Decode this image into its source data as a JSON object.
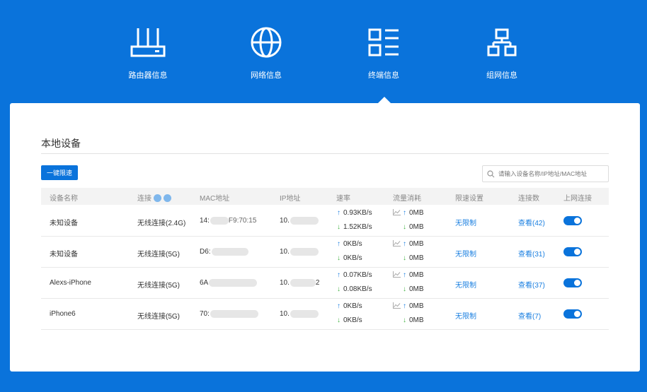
{
  "nav": [
    {
      "label": "路由器信息",
      "icon": "router-icon"
    },
    {
      "label": "网络信息",
      "icon": "globe-icon"
    },
    {
      "label": "终端信息",
      "icon": "list-icon"
    },
    {
      "label": "组网信息",
      "icon": "topology-icon"
    }
  ],
  "active_nav": "终端信息",
  "section_title": "本地设备",
  "toolbar": {
    "limit_button": "一键限速",
    "search_placeholder": "请输入设备名称/IP地址/MAC地址"
  },
  "columns": [
    "设备名称",
    "连接",
    "MAC地址",
    "IP地址",
    "速率",
    "流量消耗",
    "限速设置",
    "连接数",
    "上网连接"
  ],
  "rows": [
    {
      "name": "未知设备",
      "conn": "无线连接(2.4G)",
      "mac": "14:",
      "mac_tail": "F9:70:15",
      "ip": "10.",
      "ip_tail": "",
      "up_rate": "0.93KB/s",
      "down_rate": "1.52KB/s",
      "up_traffic": "0MB",
      "down_traffic": "0MB",
      "limit": "无限制",
      "connections": "查看(42)",
      "online": true
    },
    {
      "name": "未知设备",
      "conn": "无线连接(5G)",
      "mac": "D6:",
      "mac_tail": "",
      "ip": "10.",
      "ip_tail": "",
      "up_rate": "0KB/s",
      "down_rate": "0KB/s",
      "up_traffic": "0MB",
      "down_traffic": "0MB",
      "limit": "无限制",
      "connections": "查看(31)",
      "online": true
    },
    {
      "name": "Alexs-iPhone",
      "conn": "无线连接(5G)",
      "mac": "6A",
      "mac_tail": "",
      "ip": "10.",
      "ip_tail": "2",
      "up_rate": "0.07KB/s",
      "down_rate": "0.08KB/s",
      "up_traffic": "0MB",
      "down_traffic": "0MB",
      "limit": "无限制",
      "connections": "查看(37)",
      "online": true
    },
    {
      "name": "iPhone6",
      "conn": "无线连接(5G)",
      "mac": "70:",
      "mac_tail": "",
      "ip": "10.",
      "ip_tail": "",
      "up_rate": "0KB/s",
      "down_rate": "0KB/s",
      "up_traffic": "0MB",
      "down_traffic": "0MB",
      "limit": "无限制",
      "connections": "查看(7)",
      "online": true
    }
  ],
  "colors": {
    "brand": "#0a73db",
    "up_arrow": "#1a7fe0",
    "down_arrow": "#41b241"
  }
}
